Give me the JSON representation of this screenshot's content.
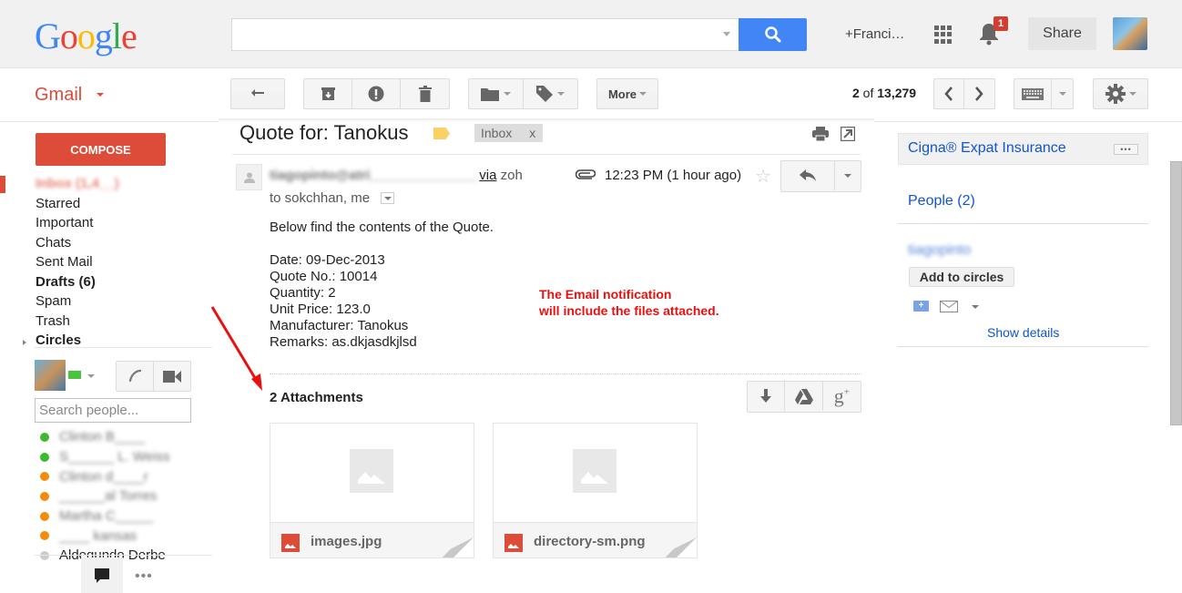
{
  "header": {
    "logo_letters": [
      {
        "ch": "G",
        "color": "#4285f4"
      },
      {
        "ch": "o",
        "color": "#ea4335"
      },
      {
        "ch": "o",
        "color": "#fbbc05"
      },
      {
        "ch": "g",
        "color": "#4285f4"
      },
      {
        "ch": "l",
        "color": "#34a853"
      },
      {
        "ch": "e",
        "color": "#ea4335"
      }
    ],
    "search_value": "",
    "search_placeholder": "",
    "user_name": "+Franci…",
    "notification_count": "1",
    "share_label": "Share"
  },
  "toolbar": {
    "app_name": "Gmail",
    "more_label": "More",
    "pager_current": "2",
    "pager_of": " of ",
    "pager_total": "13,279"
  },
  "sidebar": {
    "compose_label": "COMPOSE",
    "nav": [
      {
        "label": "Inbox (1,4__)",
        "style": "inbox"
      },
      {
        "label": "Starred",
        "style": ""
      },
      {
        "label": "Important",
        "style": ""
      },
      {
        "label": "Chats",
        "style": ""
      },
      {
        "label": "Sent Mail",
        "style": ""
      },
      {
        "label": "Drafts (6)",
        "style": "bold"
      },
      {
        "label": "Spam",
        "style": ""
      },
      {
        "label": "Trash",
        "style": ""
      },
      {
        "label": "Circles",
        "style": "bold"
      }
    ],
    "search_people_placeholder": "Search people...",
    "contacts": [
      {
        "name": "Clinton B____",
        "status": "green",
        "blurred": true
      },
      {
        "name": "S______ L. Weiss",
        "status": "green",
        "blurred": true
      },
      {
        "name": "Clinton d____r",
        "status": "orange",
        "blurred": true
      },
      {
        "name": "______al Torres",
        "status": "orange",
        "blurred": true
      },
      {
        "name": "Martha C_____",
        "status": "orange",
        "blurred": true
      },
      {
        "name": "____ kansas",
        "status": "orange",
        "blurred": true
      },
      {
        "name": "Aldegundo Derbe",
        "status": "gray",
        "blurred": false
      }
    ],
    "chat_more": "•••"
  },
  "message": {
    "subject": "Quote for: Tanokus",
    "label_color": "#fad165",
    "inbox_chip": "Inbox",
    "inbox_chip_close": "x",
    "sender_blurred": "tiagopinto@atri______________",
    "via": "via",
    "via_domain": "zoh",
    "recipients": "to sokchhan, me",
    "time": "12:23 PM (1 hour ago)",
    "body_lines": [
      "Below find the contents of the Quote.",
      "",
      "Date: 09-Dec-2013",
      "Quote No.: 10014",
      "Quantity: 2",
      "Unit Price: 123.0",
      "Manufacturer: Tanokus",
      "Remarks: as.dkjasdkjlsd"
    ],
    "annotation_lines": [
      "The Email notification",
      "will include the files attached."
    ],
    "annotation_color": "#e8110f",
    "attachments_title": "2 Attachments",
    "attachments": [
      {
        "name": "images.jpg"
      },
      {
        "name": "directory-sm.png"
      }
    ]
  },
  "right_panel": {
    "ad_title": "Cigna® Expat Insurance",
    "ad_more": "•••",
    "people_link": "People (2)",
    "person_name": "tiagopinto",
    "add_to_circles": "Add to circles",
    "show_details": "Show details"
  }
}
